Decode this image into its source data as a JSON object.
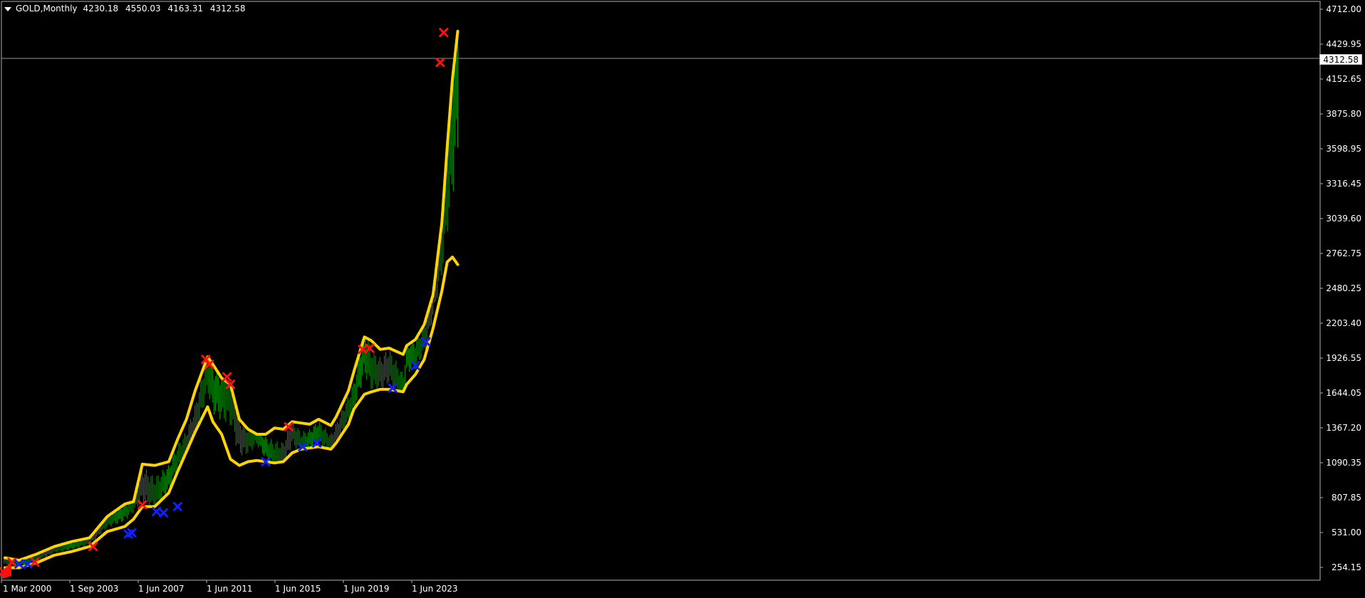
{
  "window": {
    "symbol_label": "GOLD,Monthly",
    "ohlc": {
      "open": "4230.18",
      "high": "4550.03",
      "low": "4163.31",
      "close": "4312.58"
    }
  },
  "price_axis": {
    "ticks": [
      "4712.00",
      "4429.95",
      "4152.65",
      "3875.80",
      "3598.95",
      "3316.45",
      "3039.60",
      "2762.75",
      "2480.25",
      "2203.40",
      "1926.55",
      "1644.05",
      "1367.20",
      "1090.35",
      "807.85",
      "531.00",
      "254.15"
    ],
    "current_price_tag": "4312.58"
  },
  "time_axis": {
    "labels": [
      "1 Mar 2000",
      "1 Sep 2003",
      "1 Jun 2007",
      "1 Jun 2011",
      "1 Jun 2015",
      "1 Jun 2019",
      "1 Jun 2023"
    ]
  },
  "colors": {
    "background": "#000000",
    "bar": "#00a000",
    "band": "#ffd400",
    "cross_red": "#ff1010",
    "cross_blue": "#1020ff",
    "current_line": "#8d94b1",
    "axis_text": "#ffffff",
    "frame": "#b0b0b0"
  },
  "chart_data": {
    "type": "line",
    "title": "GOLD,Monthly",
    "x_range": [
      "2000-03",
      "2025-12"
    ],
    "ylim": [
      130,
      4712
    ],
    "grid": false,
    "bars": {
      "x": [
        2000.2,
        2001.0,
        2002.0,
        2003.0,
        2004.0,
        2005.0,
        2006.0,
        2007.0,
        2007.5,
        2008.0,
        2008.7,
        2009.5,
        2010.0,
        2010.5,
        2011.0,
        2011.7,
        2012.0,
        2012.5,
        2013.0,
        2013.5,
        2014.0,
        2014.5,
        2015.0,
        2015.5,
        2016.0,
        2016.5,
        2017.0,
        2017.5,
        2018.0,
        2018.7,
        2019.0,
        2019.7,
        2020.0,
        2020.6,
        2021.0,
        2021.5,
        2022.0,
        2022.8,
        2023.0,
        2023.5,
        2024.0,
        2024.5,
        2025.0,
        2025.3,
        2025.6,
        2025.9
      ],
      "y": [
        285,
        265,
        310,
        375,
        410,
        440,
        600,
        680,
        730,
        900,
        820,
        950,
        1110,
        1220,
        1400,
        1800,
        1660,
        1600,
        1620,
        1280,
        1250,
        1300,
        1190,
        1130,
        1130,
        1320,
        1230,
        1260,
        1320,
        1220,
        1300,
        1500,
        1600,
        1970,
        1820,
        1780,
        1850,
        1660,
        1920,
        1940,
        2060,
        2350,
        2800,
        3300,
        3800,
        4312
      ]
    },
    "series": [
      {
        "name": "Upper band",
        "x": [
          2000.2,
          2001.0,
          2002.0,
          2003.0,
          2004.0,
          2005.0,
          2006.0,
          2007.0,
          2007.5,
          2008.0,
          2008.7,
          2009.5,
          2010.0,
          2010.5,
          2011.0,
          2011.7,
          2012.0,
          2012.5,
          2013.0,
          2013.5,
          2014.0,
          2014.5,
          2015.0,
          2015.5,
          2016.0,
          2016.5,
          2017.0,
          2017.5,
          2018.0,
          2018.7,
          2019.0,
          2019.7,
          2020.0,
          2020.6,
          2021.0,
          2021.5,
          2022.0,
          2022.8,
          2023.0,
          2023.5,
          2024.0,
          2024.5,
          2025.0,
          2025.3,
          2025.6,
          2025.9
        ],
        "y": [
          310,
          290,
          340,
          400,
          440,
          470,
          640,
          740,
          760,
          1060,
          1050,
          1080,
          1260,
          1420,
          1650,
          1920,
          1860,
          1750,
          1700,
          1420,
          1340,
          1300,
          1300,
          1350,
          1340,
          1400,
          1390,
          1380,
          1420,
          1370,
          1440,
          1650,
          1800,
          2080,
          2050,
          1980,
          1990,
          1940,
          2010,
          2060,
          2180,
          2420,
          3000,
          3600,
          4150,
          4530
        ]
      },
      {
        "name": "Lower band",
        "x": [
          2000.2,
          2001.0,
          2002.0,
          2003.0,
          2004.0,
          2005.0,
          2006.0,
          2007.0,
          2007.5,
          2008.0,
          2008.7,
          2009.5,
          2010.0,
          2010.5,
          2011.0,
          2011.7,
          2012.0,
          2012.5,
          2013.0,
          2013.5,
          2014.0,
          2014.5,
          2015.0,
          2015.5,
          2016.0,
          2016.5,
          2017.0,
          2017.5,
          2018.0,
          2018.7,
          2019.0,
          2019.7,
          2020.0,
          2020.6,
          2021.0,
          2021.5,
          2022.0,
          2022.8,
          2023.0,
          2023.5,
          2024.0,
          2024.5,
          2025.0,
          2025.3,
          2025.6,
          2025.9
        ],
        "y": [
          230,
          230,
          270,
          330,
          360,
          400,
          520,
          560,
          620,
          720,
          720,
          830,
          1000,
          1160,
          1320,
          1520,
          1400,
          1300,
          1100,
          1050,
          1080,
          1090,
          1080,
          1070,
          1080,
          1150,
          1180,
          1190,
          1200,
          1180,
          1230,
          1380,
          1500,
          1620,
          1640,
          1660,
          1660,
          1640,
          1700,
          1780,
          1900,
          2150,
          2450,
          2680,
          2720,
          2660
        ]
      }
    ],
    "markers": {
      "sell": [
        {
          "x": 2000.1,
          "y": 200
        },
        {
          "x": 2000.6,
          "y": 275
        },
        {
          "x": 2001.9,
          "y": 275
        },
        {
          "x": 2005.2,
          "y": 400
        },
        {
          "x": 2008.0,
          "y": 735
        },
        {
          "x": 2011.6,
          "y": 1900
        },
        {
          "x": 2011.8,
          "y": 1860
        },
        {
          "x": 2012.8,
          "y": 1760
        },
        {
          "x": 2013.0,
          "y": 1700
        },
        {
          "x": 2016.3,
          "y": 1360
        },
        {
          "x": 2020.5,
          "y": 1980
        },
        {
          "x": 2020.9,
          "y": 1990
        },
        {
          "x": 2024.9,
          "y": 4280
        },
        {
          "x": 2025.1,
          "y": 4520
        }
      ],
      "buy": [
        {
          "x": 2001.0,
          "y": 260
        },
        {
          "x": 2001.5,
          "y": 260
        },
        {
          "x": 2007.2,
          "y": 500
        },
        {
          "x": 2007.4,
          "y": 510
        },
        {
          "x": 2008.8,
          "y": 680
        },
        {
          "x": 2009.2,
          "y": 670
        },
        {
          "x": 2010.0,
          "y": 720
        },
        {
          "x": 2015.0,
          "y": 1080
        },
        {
          "x": 2017.1,
          "y": 1200
        },
        {
          "x": 2017.9,
          "y": 1230
        },
        {
          "x": 2022.2,
          "y": 1670
        },
        {
          "x": 2023.5,
          "y": 1850
        },
        {
          "x": 2024.1,
          "y": 2040
        }
      ]
    }
  }
}
